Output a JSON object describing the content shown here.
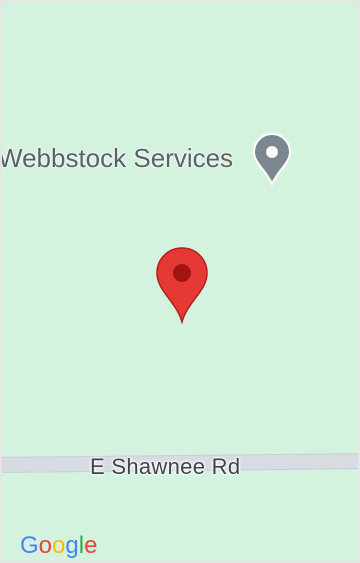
{
  "map": {
    "poi_label": "Webbstock Services",
    "road_label": "E Shawnee Rd",
    "attribution_letters": [
      "G",
      "o",
      "o",
      "g",
      "l",
      "e"
    ],
    "attribution_colors": [
      "#4285F4",
      "#EA4335",
      "#FBBC05",
      "#4285F4",
      "#34A853",
      "#EA4335"
    ],
    "colors": {
      "land": "#d4f3df",
      "marker": "#e53935",
      "poi_pin": "#7b8790"
    },
    "icons": {
      "selected_marker": "map-marker-red",
      "poi": "place-pin-gray"
    }
  }
}
